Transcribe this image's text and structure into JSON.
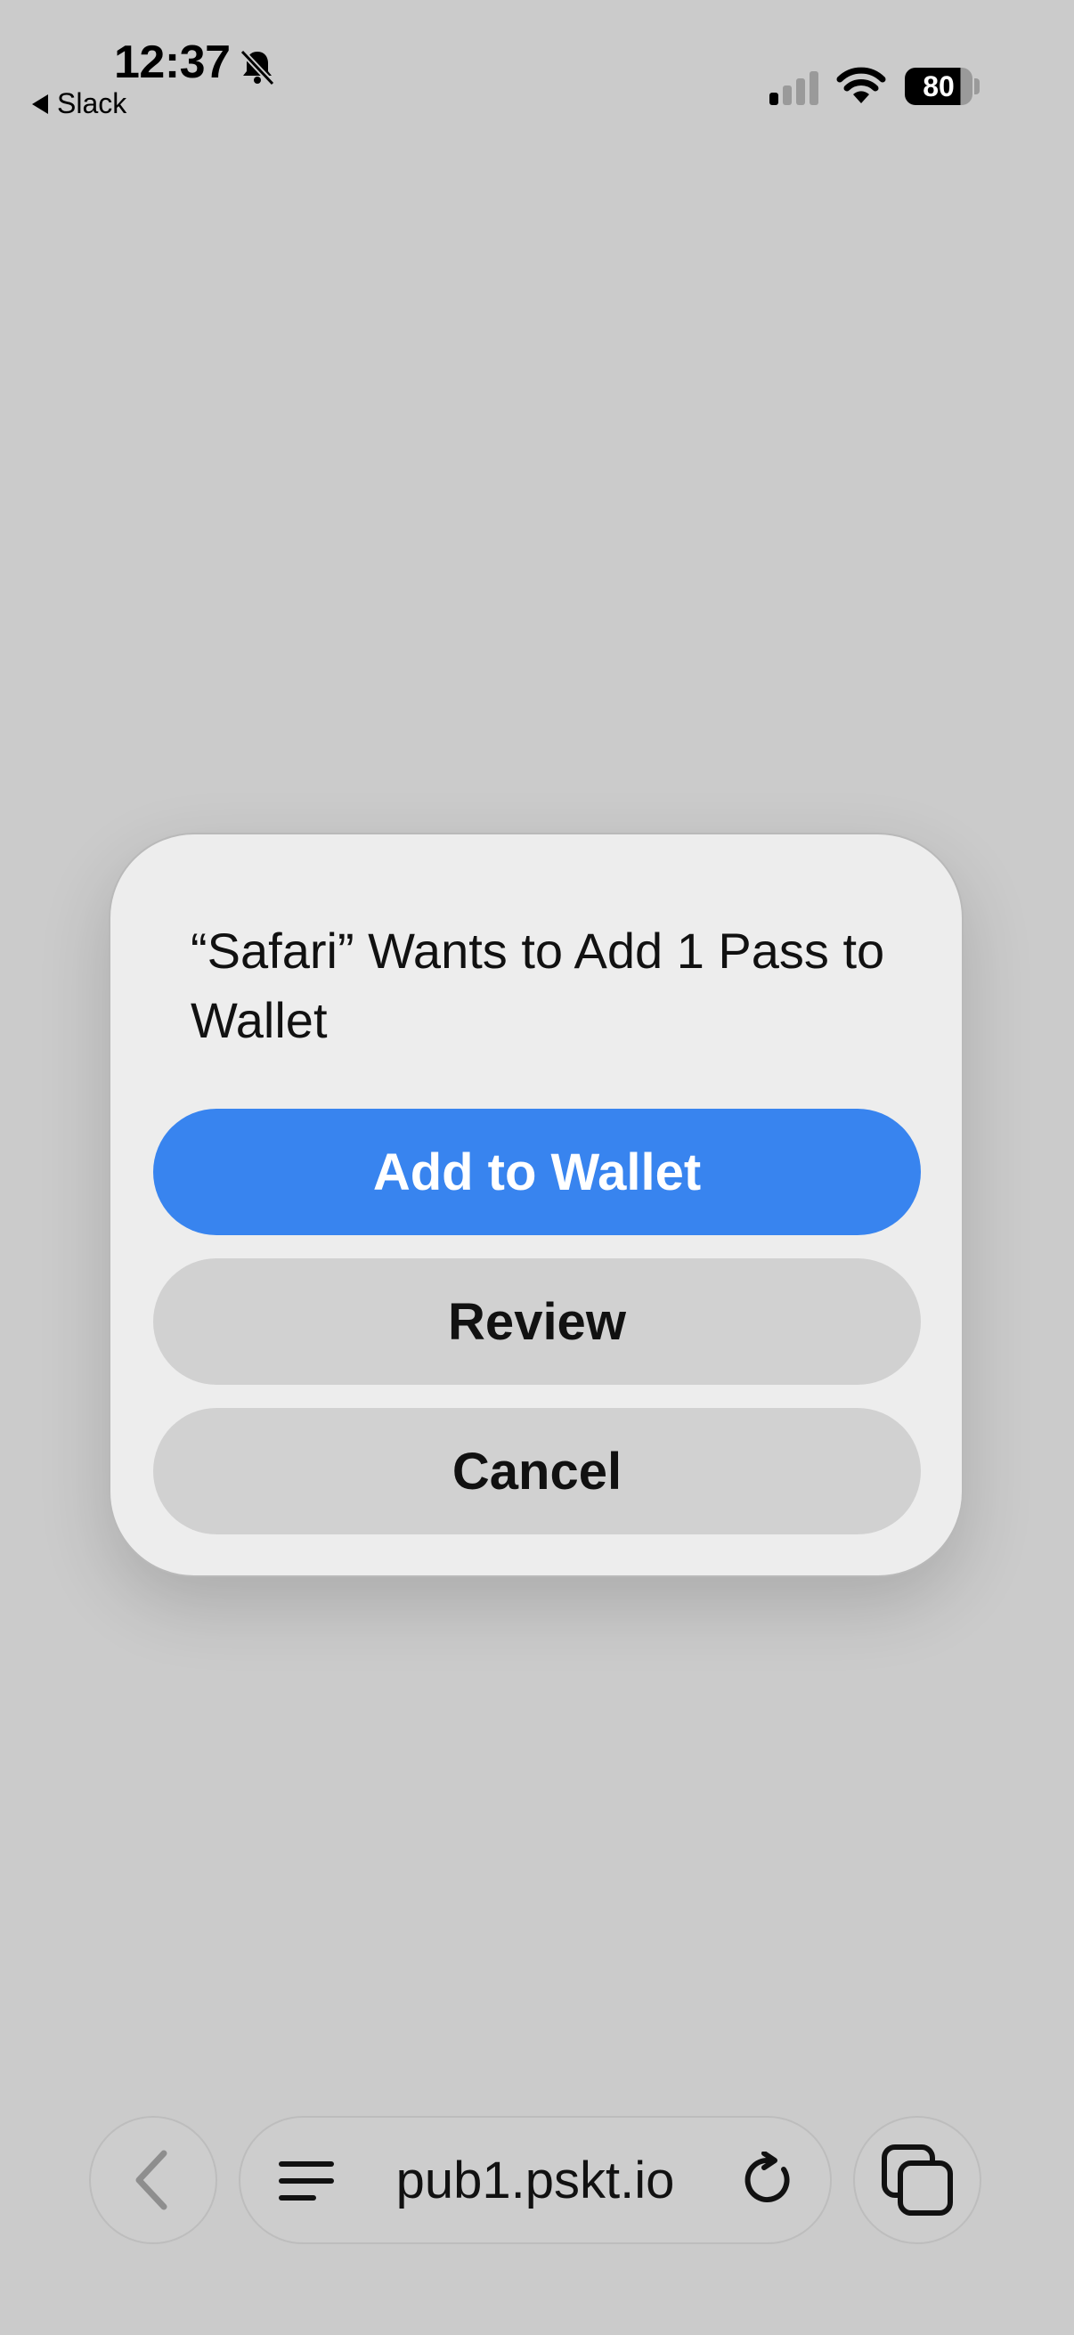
{
  "status_bar": {
    "time": "12:37",
    "back_app": "Slack",
    "battery": "80"
  },
  "dialog": {
    "title": "“Safari” Wants to Add 1 Pass to Wallet",
    "primary_button": "Add to Wallet",
    "review_button": "Review",
    "cancel_button": "Cancel"
  },
  "toolbar": {
    "url": "pub1.pskt.io"
  },
  "colors": {
    "accent": "#3884ef",
    "background": "#cbcbcb",
    "dialog_bg": "#ededed"
  },
  "icons": [
    "bell-slash-icon",
    "signal-icon",
    "wifi-icon",
    "battery-icon",
    "back-chevron-icon",
    "menu-icon",
    "reload-icon",
    "tabs-icon"
  ]
}
